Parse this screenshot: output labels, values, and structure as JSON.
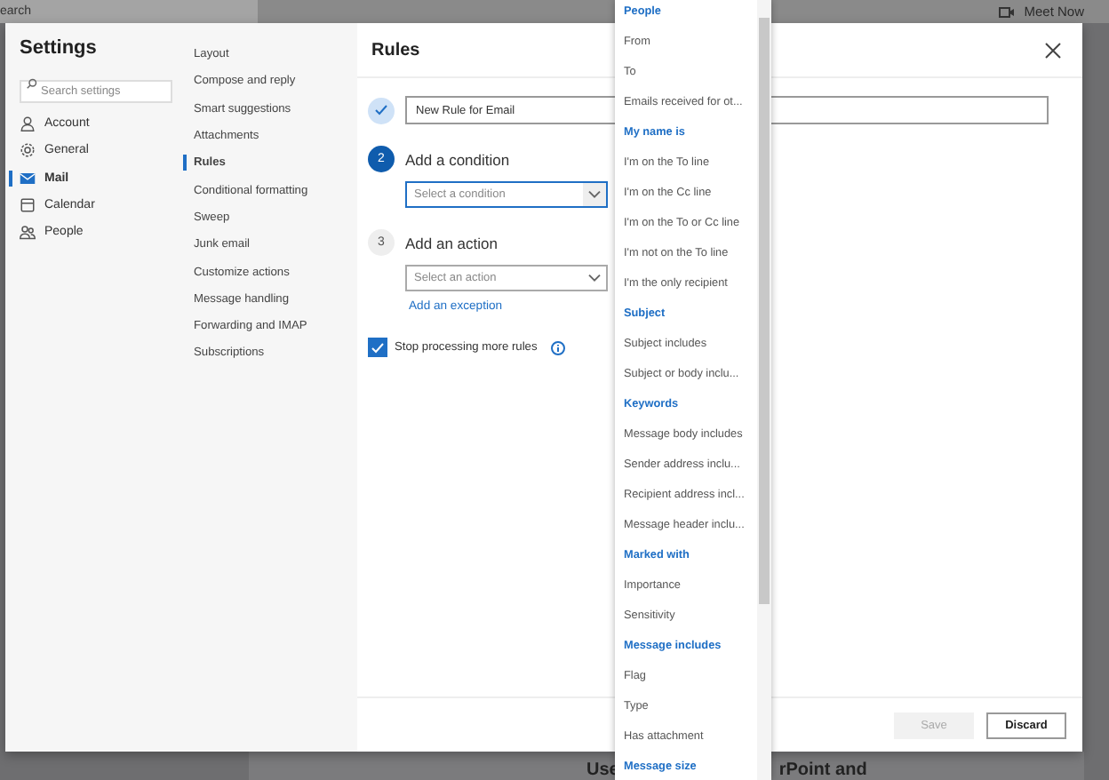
{
  "backdrop": {
    "search_fragment": "earch",
    "meet_now": "Meet Now",
    "headline_parts": [
      "Use",
      "rPoint and"
    ]
  },
  "settings": {
    "title": "Settings",
    "search": {
      "placeholder": "Search settings"
    },
    "categories": [
      {
        "label": "Account",
        "kind": "person",
        "selected": false
      },
      {
        "label": "General",
        "kind": "gear",
        "selected": false
      },
      {
        "label": "Mail",
        "kind": "mail",
        "selected": true
      },
      {
        "label": "Calendar",
        "kind": "calendar",
        "selected": false
      },
      {
        "label": "People",
        "kind": "people",
        "selected": false
      }
    ],
    "subcategories": [
      {
        "label": "Layout",
        "selected": false
      },
      {
        "label": "Compose and reply",
        "selected": false
      },
      {
        "label": "Smart suggestions",
        "selected": false
      },
      {
        "label": "Attachments",
        "selected": false
      },
      {
        "label": "Rules",
        "selected": true
      },
      {
        "label": "Conditional formatting",
        "selected": false
      },
      {
        "label": "Sweep",
        "selected": false
      },
      {
        "label": "Junk email",
        "selected": false
      },
      {
        "label": "Customize actions",
        "selected": false
      },
      {
        "label": "Message handling",
        "selected": false
      },
      {
        "label": "Forwarding and IMAP",
        "selected": false
      },
      {
        "label": "Subscriptions",
        "selected": false
      }
    ]
  },
  "rules": {
    "title": "Rules",
    "steps": [
      {
        "kind": "done",
        "value": "New Rule for Email"
      },
      {
        "kind": "current",
        "number": "2",
        "label": "Add a condition",
        "placeholder": "Select a condition"
      },
      {
        "kind": "pending",
        "number": "3",
        "label": "Add an action",
        "placeholder": "Select an action",
        "link": "Add an exception"
      }
    ],
    "stop_processing": {
      "label": "Stop processing more rules",
      "checked": true
    },
    "buttons": [
      {
        "label": "Save",
        "disabled": true
      },
      {
        "label": "Discard",
        "disabled": false
      }
    ]
  },
  "dropdown": {
    "items": [
      {
        "kind": "header",
        "label": "People"
      },
      {
        "kind": "option",
        "label": "From"
      },
      {
        "kind": "option",
        "label": "To"
      },
      {
        "kind": "option",
        "label": "Emails received for ot..."
      },
      {
        "kind": "header",
        "label": "My name is"
      },
      {
        "kind": "option",
        "label": "I'm on the To line"
      },
      {
        "kind": "option",
        "label": "I'm on the Cc line"
      },
      {
        "kind": "option",
        "label": "I'm on the To or Cc line"
      },
      {
        "kind": "option",
        "label": "I'm not on the To line"
      },
      {
        "kind": "option",
        "label": "I'm the only recipient"
      },
      {
        "kind": "header",
        "label": "Subject"
      },
      {
        "kind": "option",
        "label": "Subject includes"
      },
      {
        "kind": "option",
        "label": "Subject or body inclu..."
      },
      {
        "kind": "header",
        "label": "Keywords"
      },
      {
        "kind": "option",
        "label": "Message body includes"
      },
      {
        "kind": "option",
        "label": "Sender address inclu..."
      },
      {
        "kind": "option",
        "label": "Recipient address incl..."
      },
      {
        "kind": "option",
        "label": "Message header inclu..."
      },
      {
        "kind": "header",
        "label": "Marked with"
      },
      {
        "kind": "option",
        "label": "Importance"
      },
      {
        "kind": "option",
        "label": "Sensitivity"
      },
      {
        "kind": "header",
        "label": "Message includes"
      },
      {
        "kind": "option",
        "label": "Flag"
      },
      {
        "kind": "option",
        "label": "Type"
      },
      {
        "kind": "option",
        "label": "Has attachment"
      },
      {
        "kind": "header",
        "label": "Message size"
      }
    ]
  }
}
